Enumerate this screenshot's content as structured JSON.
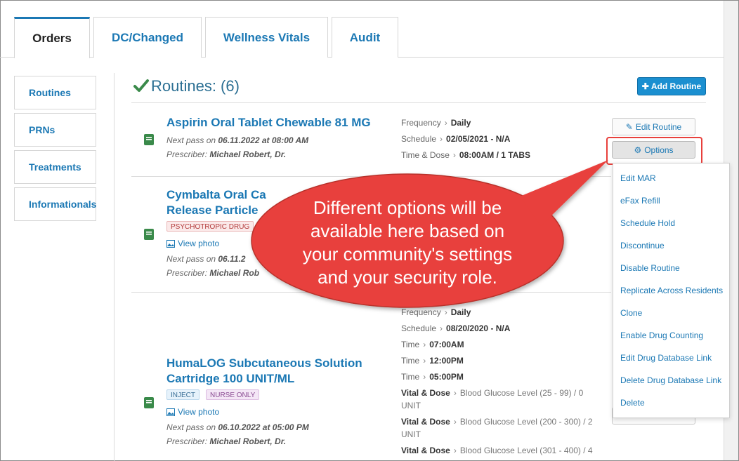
{
  "tabs": [
    {
      "label": "Orders",
      "active": true
    },
    {
      "label": "DC/Changed",
      "active": false
    },
    {
      "label": "Wellness Vitals",
      "active": false
    },
    {
      "label": "Audit",
      "active": false
    }
  ],
  "sidenav": [
    "Routines",
    "PRNs",
    "Treatments",
    "Informationals"
  ],
  "header": {
    "title": "Routines: (6)",
    "add_label": "Add Routine"
  },
  "routines": [
    {
      "name": "Aspirin Oral Tablet Chewable 81 MG",
      "next_pass_prefix": "Next pass on ",
      "next_pass": "06.11.2022 at 08:00 AM",
      "prescriber_prefix": "Prescriber: ",
      "prescriber": "Michael Robert, Dr.",
      "details": [
        {
          "label": "Frequency",
          "value": "Daily"
        },
        {
          "label": "Schedule",
          "value": "02/05/2021 - N/A"
        },
        {
          "label": "Time & Dose",
          "value": "08:00AM / 1 TABS"
        }
      ]
    },
    {
      "name_line1": "Cymbalta Oral Ca",
      "name_line2": "Release Particle",
      "tags": [
        "PSYCHOTROPIC DRUG"
      ],
      "view_photo": "View photo",
      "next_pass_prefix": "Next pass on ",
      "next_pass": "06.11.2",
      "prescriber_prefix": "Prescriber: ",
      "prescriber": "Michael Rob"
    },
    {
      "name_line1": "HumaLOG Subcutaneous Solution",
      "name_line2": "Cartridge 100 UNIT/ML",
      "tags": [
        "INJECT",
        "NURSE ONLY"
      ],
      "view_photo": "View photo",
      "next_pass_prefix": "Next pass on ",
      "next_pass": "06.10.2022 at 05:00 PM",
      "prescriber_prefix": "Prescriber: ",
      "prescriber": "Michael Robert, Dr.",
      "details": [
        {
          "label": "Frequency",
          "value": "Daily"
        },
        {
          "label": "Schedule",
          "value": "08/20/2020 - N/A"
        },
        {
          "label": "Time",
          "value": "07:00AM"
        },
        {
          "label": "Time",
          "value": "12:00PM"
        },
        {
          "label": "Time",
          "value": "05:00PM"
        }
      ],
      "vitals": [
        {
          "label": "Vital & Dose",
          "line1": "Blood Glucose Level (25 - 99) / 0",
          "line2": "UNIT"
        },
        {
          "label": "Vital & Dose",
          "line1": "Blood Glucose Level (200 - 300) / 2",
          "line2": "UNIT"
        },
        {
          "label": "Vital & Dose",
          "line1": "Blood Glucose Level (301 - 400) / 4",
          "line2": ""
        }
      ]
    }
  ],
  "buttons": {
    "edit": "Edit Routine",
    "options": "Options"
  },
  "options_menu": [
    "Edit MAR",
    "eFax Refill",
    "Schedule Hold",
    "Discontinue",
    "Disable Routine",
    "Replicate Across Residents",
    "Clone",
    "Enable Drug Counting",
    "Edit Drug Database Link",
    "Delete Drug Database Link",
    "Delete"
  ],
  "callout": {
    "line1": "Different options will be",
    "line2": "available here based on",
    "line3": "your community's settings",
    "line4": "and your security role."
  },
  "colors": {
    "accent": "#1b78b4",
    "callout": "#e8403c",
    "check": "#3a8a4a"
  }
}
